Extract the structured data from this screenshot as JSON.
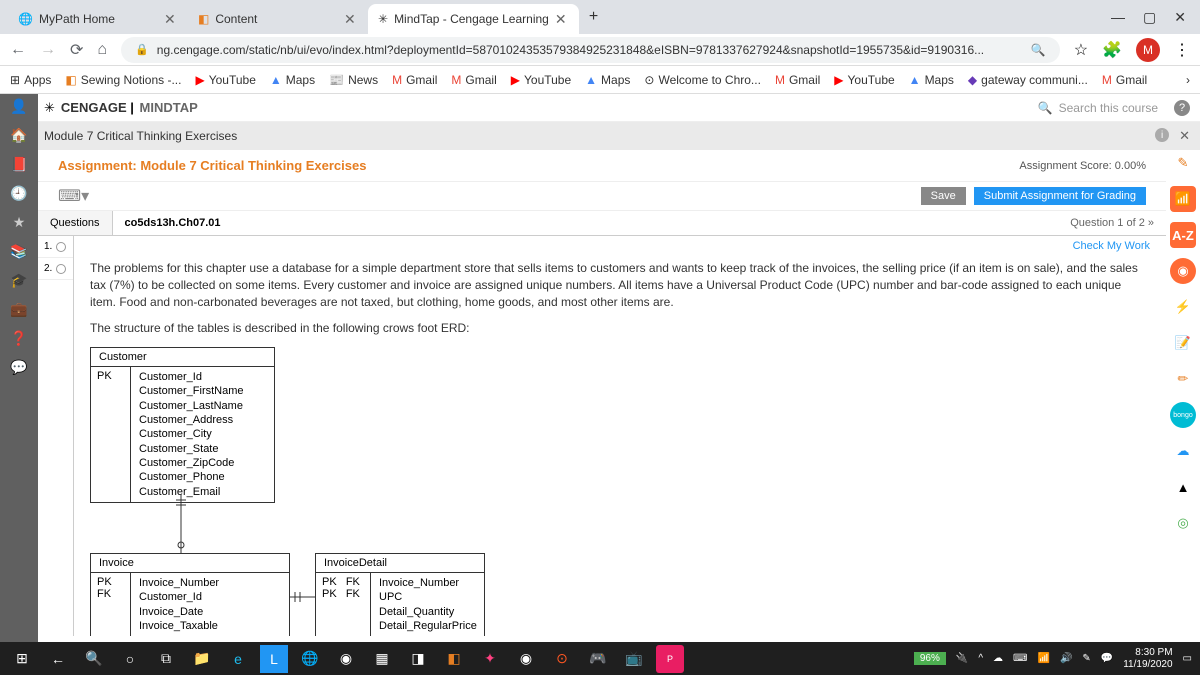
{
  "browser": {
    "tabs": [
      {
        "title": "MyPath Home"
      },
      {
        "title": "Content"
      },
      {
        "title": "MindTap - Cengage Learning"
      }
    ],
    "url": "ng.cengage.com/static/nb/ui/evo/index.html?deploymentId=58701024353579384925231848&eISBN=9781337627924&snapshotId=1955735&id=9190316...",
    "bookmarks": [
      "Apps",
      "Sewing Notions -...",
      "YouTube",
      "Maps",
      "News",
      "Gmail",
      "Gmail",
      "YouTube",
      "Maps",
      "Welcome to Chro...",
      "Gmail",
      "YouTube",
      "Maps",
      "gateway communi...",
      "Gmail"
    ]
  },
  "mindtap": {
    "brand1": "CENGAGE",
    "brand2": "MINDTAP",
    "search_placeholder": "Search this course",
    "module": "Module 7 Critical Thinking Exercises"
  },
  "assignment": {
    "title": "Assignment: Module 7 Critical Thinking Exercises",
    "score": "Assignment Score: 0.00%",
    "save_btn": "Save",
    "submit_btn": "Submit Assignment for Grading"
  },
  "question": {
    "label": "Questions",
    "file": "co5ds13h.Ch07.01",
    "counter": "Question 1 of 2 »",
    "check_work": "Check My Work",
    "items": [
      "1.",
      "2."
    ]
  },
  "problem": {
    "p1": "The problems for this chapter use a database for a simple department store that sells items to customers and wants to keep track of the invoices, the selling price (if an item is on sale), and the sales tax (7%) to be collected on some items. Every customer and invoice are assigned unique numbers. All items have a Universal Product Code (UPC) number and bar-code assigned to each unique item. Food and non-carbonated beverages are not taxed, but clothing, home goods, and most other items are.",
    "p2": "The structure of the tables is described in the following crows foot ERD:"
  },
  "erd": {
    "customer": {
      "name": "Customer",
      "pk": "PK",
      "fields": "Customer_Id\nCustomer_FirstName\nCustomer_LastName\nCustomer_Address\nCustomer_City\nCustomer_State\nCustomer_ZipCode\nCustomer_Phone\nCustomer_Email"
    },
    "invoice": {
      "name": "Invoice",
      "pk": "PK\nFK",
      "fields": "Invoice_Number\nCustomer_Id\nInvoice_Date\nInvoice_Taxable"
    },
    "detail": {
      "name": "InvoiceDetail",
      "pk": "PK   FK\nPK   FK",
      "fields": "Invoice_Number\nUPC\nDetail_Quantity\nDetail_RegularPrice"
    }
  },
  "right_tools": {
    "az": "A-Z"
  },
  "taskbar": {
    "battery": "96%",
    "time": "8:30 PM",
    "date": "11/19/2020"
  }
}
